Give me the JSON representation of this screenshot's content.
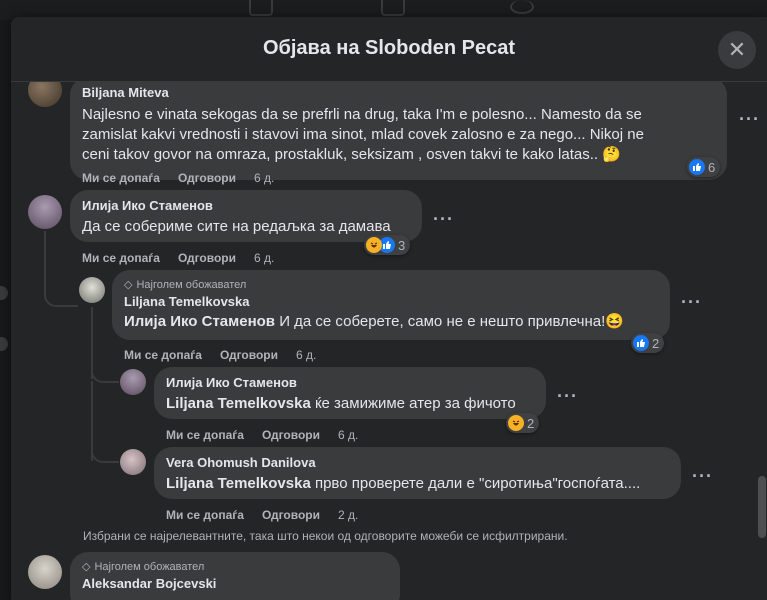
{
  "modal": {
    "title": "Објава на Sloboden Pecat",
    "close_label": "✕"
  },
  "actions_labels": {
    "like": "Ми се допаѓа",
    "reply": "Одговори"
  },
  "comments": [
    {
      "author": "Biljana Miteva",
      "lines": [
        "Najlesno e vinata sekogas da se prefrli na drug, taka I'm e polesno... Namesto da se",
        "zamislat kakvi vrednosti i stavovi ima sinot, mlad covek zalosno e za nego... Nikoj ne",
        "ceni takov govor na omraza, prostakluk, seksizam , osven takvi te kako latas.. 🤔"
      ],
      "time": "6 д.",
      "reactions": "6"
    },
    {
      "author": "Илија Ико Стаменов",
      "text": "Да се собериме сите на редаљка за дамава",
      "time": "6 д.",
      "reactions": "3"
    },
    {
      "badge": "Најголем обожавател",
      "author": "Liljana Temelkovska",
      "mention": "Илија Ико Стаменов",
      "text": " И да се соберете, само не е нешто привлечна!😆",
      "time": "6 д.",
      "reactions": "2"
    },
    {
      "author": "Илија Ико Стаменов",
      "mention": "Liljana Temelkovska",
      "text": " ќе замижиме атер за фичото",
      "time": "6 д.",
      "reactions": "2"
    },
    {
      "author": "Vera Ohomush Danilova",
      "mention": "Liljana Temelkovska",
      "text": " прво проверете дали е \"сиротиња\"госпоѓата....",
      "time": "2 д."
    },
    {
      "badge": "Најголем обожавател",
      "author": "Aleksandar Bojcevski"
    }
  ],
  "filter_note": "Избрани се најрелевантните, така што некои од одговорите можеби се исфилтрирани.",
  "colors": {
    "like": "#1877f2",
    "haha": "#f7b125",
    "bubble": "#3a3b3c",
    "modal": "#242526"
  }
}
